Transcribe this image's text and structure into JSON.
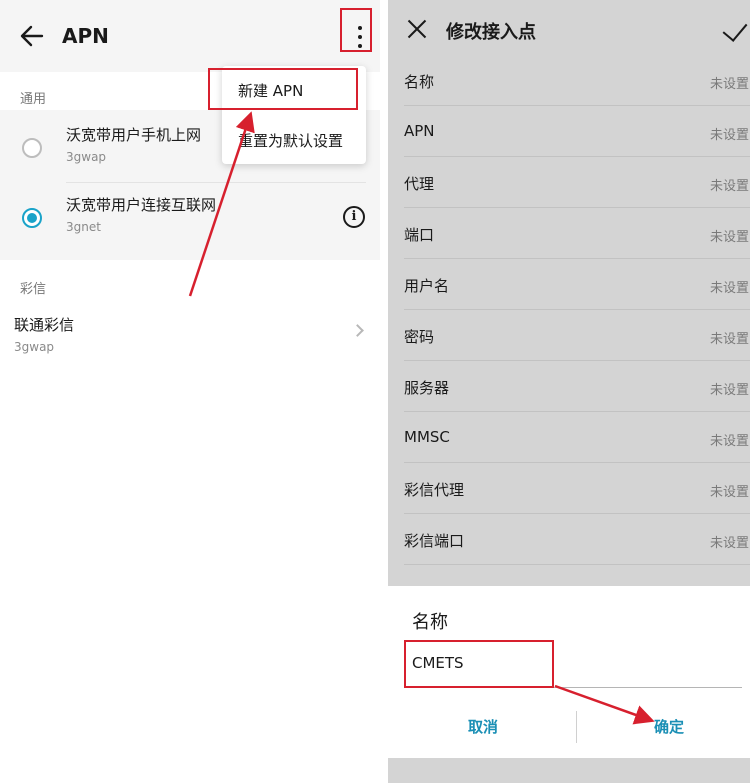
{
  "left": {
    "title": "APN",
    "menu": {
      "new_apn": "新建 APN",
      "reset_default": "重置为默认设置"
    },
    "general_section": "通用",
    "general_items": [
      {
        "name": "沃宽带用户手机上网",
        "type": "3gwap",
        "selected": false
      },
      {
        "name": "沃宽带用户连接互联网",
        "type": "3gnet",
        "selected": true
      }
    ],
    "mms_section": "彩信",
    "mms_items": [
      {
        "name": "联通彩信",
        "type": "3gwap"
      }
    ]
  },
  "right": {
    "title": "修改接入点",
    "fields": [
      {
        "label": "名称",
        "value": "未设置"
      },
      {
        "label": "APN",
        "value": "未设置"
      },
      {
        "label": "代理",
        "value": "未设置"
      },
      {
        "label": "端口",
        "value": "未设置"
      },
      {
        "label": "用户名",
        "value": "未设置"
      },
      {
        "label": "密码",
        "value": "未设置"
      },
      {
        "label": "服务器",
        "value": "未设置"
      },
      {
        "label": "MMSC",
        "value": "未设置"
      },
      {
        "label": "彩信代理",
        "value": "未设置"
      },
      {
        "label": "彩信端口",
        "value": "未设置"
      }
    ],
    "dialog": {
      "title": "名称",
      "input_value": "CMETS",
      "cancel": "取消",
      "confirm": "确定"
    }
  },
  "colors": {
    "highlight": "#d7202e",
    "accent": "#1aa3c9",
    "dialog_button": "#1a8fb5"
  }
}
